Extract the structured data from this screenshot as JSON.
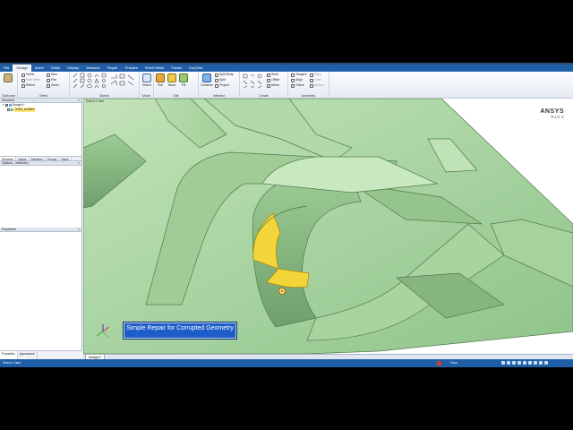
{
  "ribbon": {
    "tabs": [
      "File",
      "Design",
      "Insert",
      "Detail",
      "Display",
      "Measure",
      "Repair",
      "Prepare",
      "Sheet Metal",
      "Facets",
      "KeyShot"
    ],
    "active_tab": "Design",
    "groups": {
      "clipboard": "Clipboard",
      "orient": "Orient",
      "sketch": "Sketch",
      "mode": "Mode",
      "edit": "Edit",
      "intersect": "Intersect",
      "create": "Create",
      "assembly": "Assembly"
    },
    "orient_items": [
      "Home",
      "Plan View",
      "Select",
      "Spin",
      "Pan",
      "Zoom"
    ],
    "edit_items": [
      "Select",
      "Pull",
      "Move",
      "Fill"
    ],
    "intersect_items": [
      "Combine",
      "Split Body",
      "Split",
      "Project"
    ],
    "create_items": [
      "Shell",
      "Offset",
      "Mirror"
    ],
    "assembly_items": [
      "Tangent",
      "Align",
      "Orient",
      "Rigid",
      "Gear",
      "Anchor"
    ]
  },
  "structure": {
    "title": "Structure",
    "tree": [
      {
        "label": "Design1*"
      },
      {
        "label": "Solid_created"
      }
    ],
    "subtabs": [
      "Structure",
      "Layers",
      "Selection",
      "Groups",
      "Views"
    ]
  },
  "options": {
    "title": "Options - Selection"
  },
  "properties": {
    "title": "Properties"
  },
  "left_bottom_tabs": [
    "Properties",
    "Appearance"
  ],
  "viewport": {
    "hint": "Select 1 face",
    "brand": "ANSYS",
    "version": "R18.0",
    "caption": "Simple Repair for Corrupted Geometry",
    "doc_tab": "Design1*"
  },
  "status": {
    "left": "Select 1 face",
    "view": "Face"
  },
  "colors": {
    "model_fill": "#a8d5a0",
    "selected_face": "#f3d53a",
    "ribbon_blue": "#1f5fa8",
    "caption_bg": "#1d5cc9"
  }
}
